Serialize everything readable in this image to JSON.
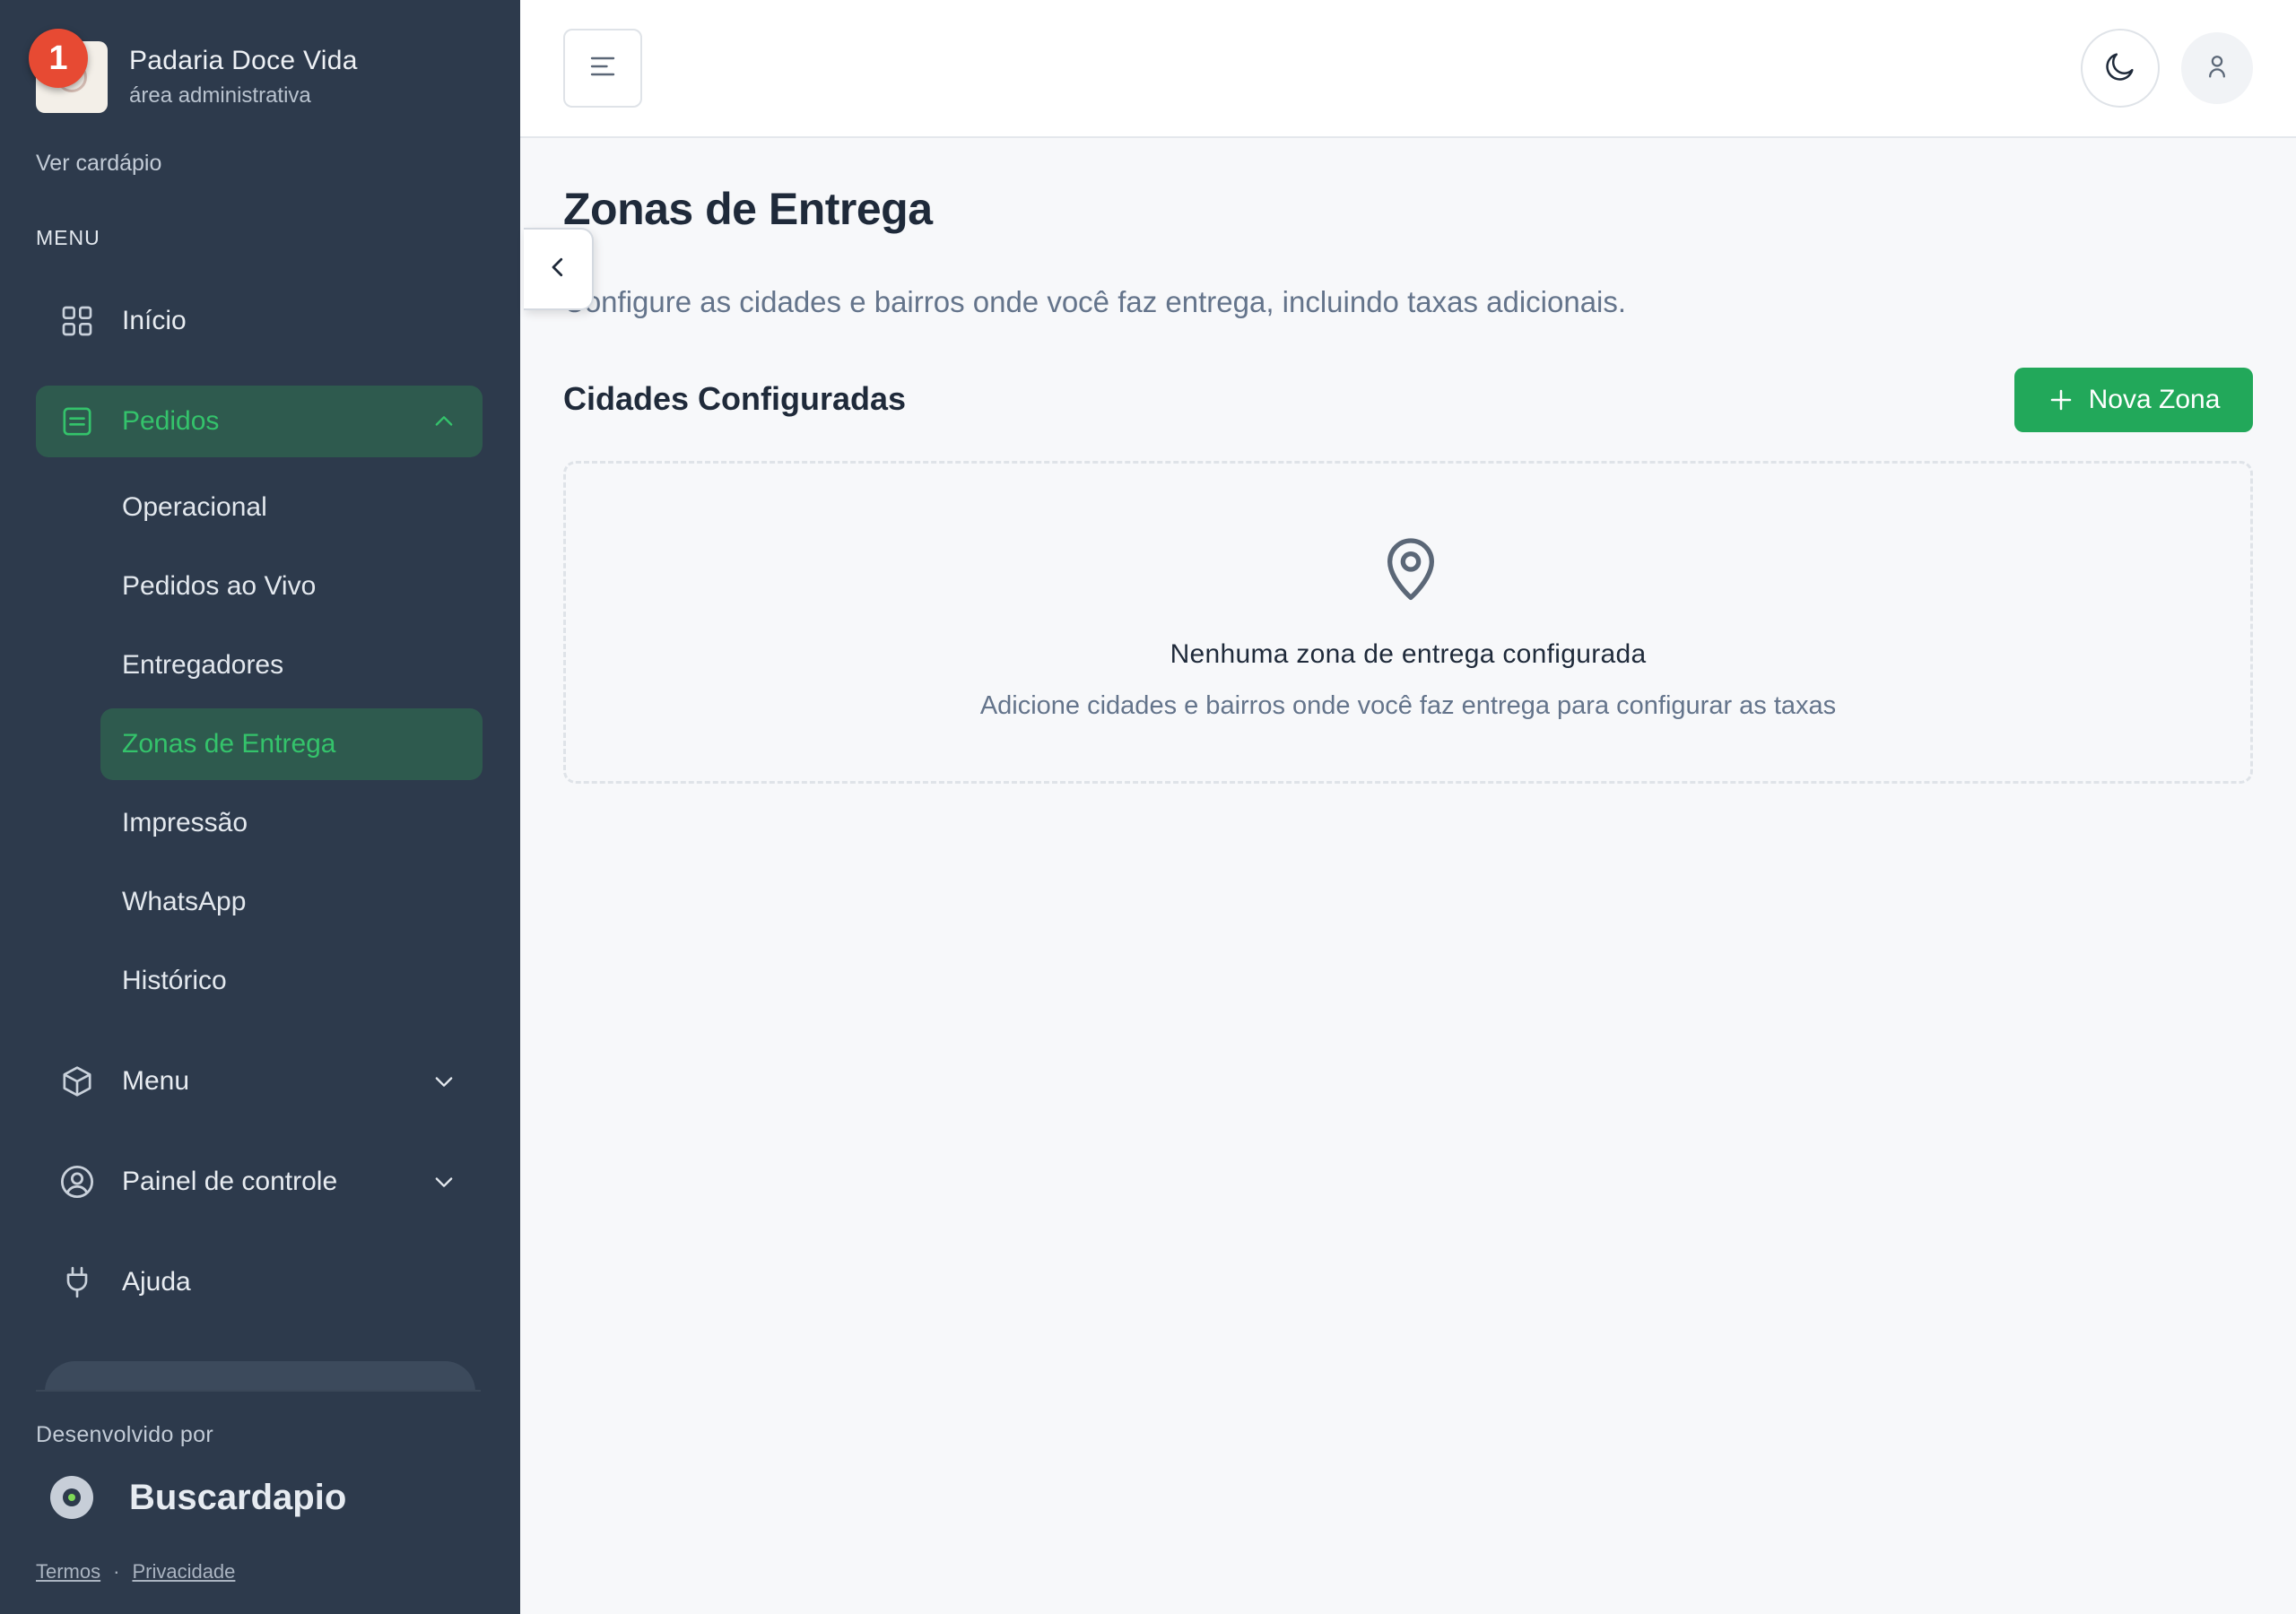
{
  "sidebar": {
    "brand_name": "Padaria Doce Vida",
    "brand_sub": "área administrativa",
    "notification_count": "1",
    "view_menu": "Ver cardápio",
    "section_label": "MENU",
    "items": {
      "inicio": "Início",
      "pedidos": "Pedidos",
      "menu": "Menu",
      "painel": "Painel de controle",
      "ajuda": "Ajuda"
    },
    "sub_items": [
      "Operacional",
      "Pedidos ao Vivo",
      "Entregadores",
      "Zonas de Entrega",
      "Impressão",
      "WhatsApp",
      "Histórico"
    ],
    "active_sub_item": "Zonas de Entrega",
    "developed_by": "Desenvolvido por",
    "dev_brand": "Buscardapio",
    "terms": "Termos",
    "privacy": "Privacidade",
    "separator": "·"
  },
  "topbar": {
    "icons": [
      "menu-icon",
      "moon-icon",
      "user-icon"
    ]
  },
  "main": {
    "title": "Zonas de Entrega",
    "description": "Configure as cidades e bairros onde você faz entrega, incluindo taxas adicionais.",
    "section_title": "Cidades Configuradas",
    "new_zone_button": "Nova Zona",
    "empty_title": "Nenhuma zona de entrega configurada",
    "empty_description": "Adicione cidades e bairros onde você faz entrega para configurar as taxas"
  },
  "colors": {
    "sidebar_bg": "#2d3a4c",
    "accent_green": "#22a85a",
    "active_bg": "#2e5a4e",
    "badge_red": "#e74a33"
  }
}
